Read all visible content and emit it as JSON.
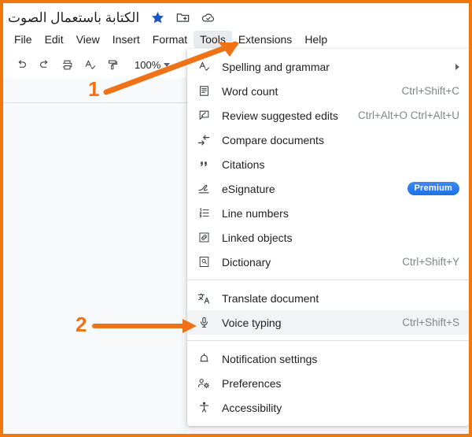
{
  "window": {
    "frame_color": "#f1760d",
    "app_background": "#ffffff"
  },
  "titlebar": {
    "document_title": "الكتابة باستعمال الصوت",
    "icons": [
      {
        "name": "star-icon",
        "label": "Star",
        "color": "#1a56c4"
      },
      {
        "name": "move-to-folder-icon",
        "label": "Move to folder"
      },
      {
        "name": "cloud-saved-icon",
        "label": "Saved to Drive"
      }
    ]
  },
  "menubar": {
    "items": [
      {
        "label": "File",
        "active": false
      },
      {
        "label": "Edit",
        "active": false
      },
      {
        "label": "View",
        "active": false
      },
      {
        "label": "Insert",
        "active": false
      },
      {
        "label": "Format",
        "active": false
      },
      {
        "label": "Tools",
        "active": true
      },
      {
        "label": "Extensions",
        "active": false
      },
      {
        "label": "Help",
        "active": false
      }
    ]
  },
  "toolbar": {
    "buttons": [
      {
        "name": "undo-icon",
        "label": "Undo"
      },
      {
        "name": "redo-icon",
        "label": "Redo"
      },
      {
        "name": "print-icon",
        "label": "Print"
      },
      {
        "name": "spelling-check-icon",
        "label": "Spelling and grammar check"
      },
      {
        "name": "paint-format-icon",
        "label": "Paint format"
      }
    ],
    "zoom_value": "100%"
  },
  "tools_menu": {
    "highlighted_item": "Voice typing",
    "groups": [
      {
        "items": [
          {
            "icon": "spelling-grammar-icon",
            "label": "Spelling and grammar",
            "shortcut": "",
            "submenu": true,
            "badge": ""
          },
          {
            "icon": "word-count-icon",
            "label": "Word count",
            "shortcut": "Ctrl+Shift+C",
            "submenu": false,
            "badge": ""
          },
          {
            "icon": "review-suggested-edits-icon",
            "label": "Review suggested edits",
            "shortcut": "Ctrl+Alt+O Ctrl+Alt+U",
            "submenu": false,
            "badge": ""
          },
          {
            "icon": "compare-documents-icon",
            "label": "Compare documents",
            "shortcut": "",
            "submenu": false,
            "badge": ""
          },
          {
            "icon": "citations-icon",
            "label": "Citations",
            "shortcut": "",
            "submenu": false,
            "badge": ""
          },
          {
            "icon": "esignature-icon",
            "label": "eSignature",
            "shortcut": "",
            "submenu": false,
            "badge": "Premium"
          },
          {
            "icon": "line-numbers-icon",
            "label": "Line numbers",
            "shortcut": "",
            "submenu": false,
            "badge": ""
          },
          {
            "icon": "linked-objects-icon",
            "label": "Linked objects",
            "shortcut": "",
            "submenu": false,
            "badge": ""
          },
          {
            "icon": "dictionary-icon",
            "label": "Dictionary",
            "shortcut": "Ctrl+Shift+Y",
            "submenu": false,
            "badge": ""
          }
        ]
      },
      {
        "items": [
          {
            "icon": "translate-document-icon",
            "label": "Translate document",
            "shortcut": "",
            "submenu": false,
            "badge": ""
          },
          {
            "icon": "voice-typing-icon",
            "label": "Voice typing",
            "shortcut": "Ctrl+Shift+S",
            "submenu": false,
            "badge": ""
          }
        ]
      },
      {
        "items": [
          {
            "icon": "notification-settings-icon",
            "label": "Notification settings",
            "shortcut": "",
            "submenu": false,
            "badge": ""
          },
          {
            "icon": "preferences-icon",
            "label": "Preferences",
            "shortcut": "",
            "submenu": false,
            "badge": ""
          },
          {
            "icon": "accessibility-icon",
            "label": "Accessibility",
            "shortcut": "",
            "submenu": false,
            "badge": ""
          }
        ]
      }
    ]
  },
  "annotations": {
    "color": "#ef7216",
    "markers": [
      {
        "number": "1",
        "points_to": "Tools"
      },
      {
        "number": "2",
        "points_to": "Voice typing"
      }
    ]
  }
}
